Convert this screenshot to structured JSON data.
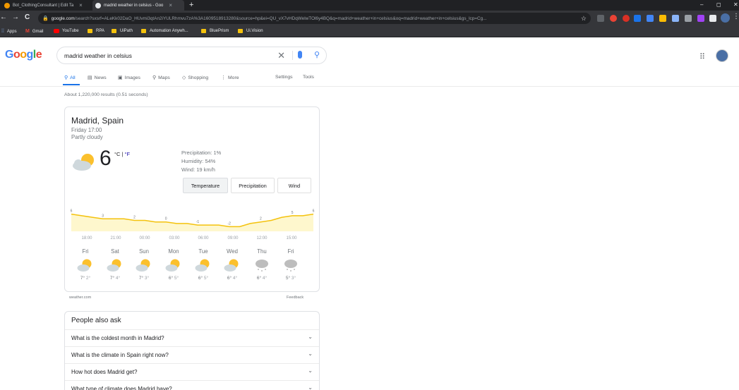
{
  "browser": {
    "tabs": [
      {
        "title": "Bot_ClothingConsultant | Edit Ta",
        "active": false
      },
      {
        "title": "madrid weather in celsius - Goo",
        "active": true
      }
    ],
    "new_tab": "+",
    "close": "×",
    "window_controls": {
      "minimize": "–",
      "maximize": "◻",
      "close": "✕"
    },
    "nav": {
      "back": "←",
      "forward": "→",
      "reload": "C"
    },
    "address": {
      "host": "google.com",
      "path": "/search?sxsrf=ALeKk02DaO_HUvmi3qtAn2iYULRhmvu7zA%3A1609518913280&source=hp&ei=QU_vX7vHDqWelwTOl6y4BQ&q=madrid+weather+in+celsius&oq=madrid+weather+in+celsius&gs_lcp=Cg..."
    },
    "bookmarks": [
      "Apps",
      "Gmail",
      "YouTube",
      "RPA",
      "UiPath",
      "Automation Anywh...",
      "BluePrism",
      "Ui.Vision"
    ]
  },
  "search": {
    "logo": "Google",
    "query": "madrid weather in celsius",
    "tabs": [
      "All",
      "News",
      "Images",
      "Maps",
      "Shopping",
      "More"
    ],
    "settings": "Settings",
    "tools": "Tools",
    "stats": "About 1,220,000 results (0.51 seconds)"
  },
  "weather": {
    "location": "Madrid, Spain",
    "day_time": "Friday 17:00",
    "condition": "Partly cloudy",
    "temperature": "6",
    "unit_c": "°C",
    "unit_sep": " | ",
    "unit_f": "°F",
    "precipitation": "Precipitation: 1%",
    "humidity": "Humidity: 54%",
    "wind": "Wind: 19 km/h",
    "buttons": [
      "Temperature",
      "Precipitation",
      "Wind"
    ],
    "selected_button": "Temperature",
    "source": "weather.com",
    "feedback": "Feedback",
    "hours": [
      "18:00",
      "21:00",
      "00:00",
      "03:00",
      "06:00",
      "09:00",
      "12:00",
      "15:00"
    ],
    "forecast": [
      {
        "day": "Fri",
        "high": "7°",
        "low": "2°",
        "icon": "partly-cloudy"
      },
      {
        "day": "Sat",
        "high": "7°",
        "low": "4°",
        "icon": "partly-cloudy"
      },
      {
        "day": "Sun",
        "high": "7°",
        "low": "3°",
        "icon": "partly-cloudy"
      },
      {
        "day": "Mon",
        "high": "6°",
        "low": "5°",
        "icon": "partly-cloudy"
      },
      {
        "day": "Tue",
        "high": "6°",
        "low": "5°",
        "icon": "partly-cloudy"
      },
      {
        "day": "Wed",
        "high": "6°",
        "low": "4°",
        "icon": "partly-cloudy"
      },
      {
        "day": "Thu",
        "high": "6°",
        "low": "4°",
        "icon": "snow"
      },
      {
        "day": "Fri",
        "high": "5°",
        "low": "3°",
        "icon": "snow"
      }
    ]
  },
  "chart_data": {
    "type": "area",
    "x": [
      "17:00",
      "18:00",
      "19:00",
      "20:00",
      "21:00",
      "22:00",
      "23:00",
      "00:00",
      "01:00",
      "02:00",
      "03:00",
      "04:00",
      "05:00",
      "06:00",
      "07:00",
      "08:00",
      "09:00",
      "10:00",
      "11:00",
      "12:00",
      "13:00",
      "14:00",
      "15:00",
      "16:00"
    ],
    "values": [
      6,
      5,
      4,
      3,
      3,
      3,
      2,
      2,
      1,
      1,
      0,
      0,
      -1,
      -1,
      -1,
      -2,
      -2,
      0,
      1,
      2,
      4,
      5,
      5,
      6
    ],
    "labels": [
      {
        "index": 0,
        "text": "6"
      },
      {
        "index": 3,
        "text": "3"
      },
      {
        "index": 6,
        "text": "2"
      },
      {
        "index": 9,
        "text": "0"
      },
      {
        "index": 12,
        "text": "-1"
      },
      {
        "index": 15,
        "text": "-2"
      },
      {
        "index": 18,
        "text": "2"
      },
      {
        "index": 21,
        "text": "5"
      },
      {
        "index": 23,
        "text": "6"
      }
    ],
    "fill": "#fef7cd",
    "stroke": "#f4c20d"
  }
}
